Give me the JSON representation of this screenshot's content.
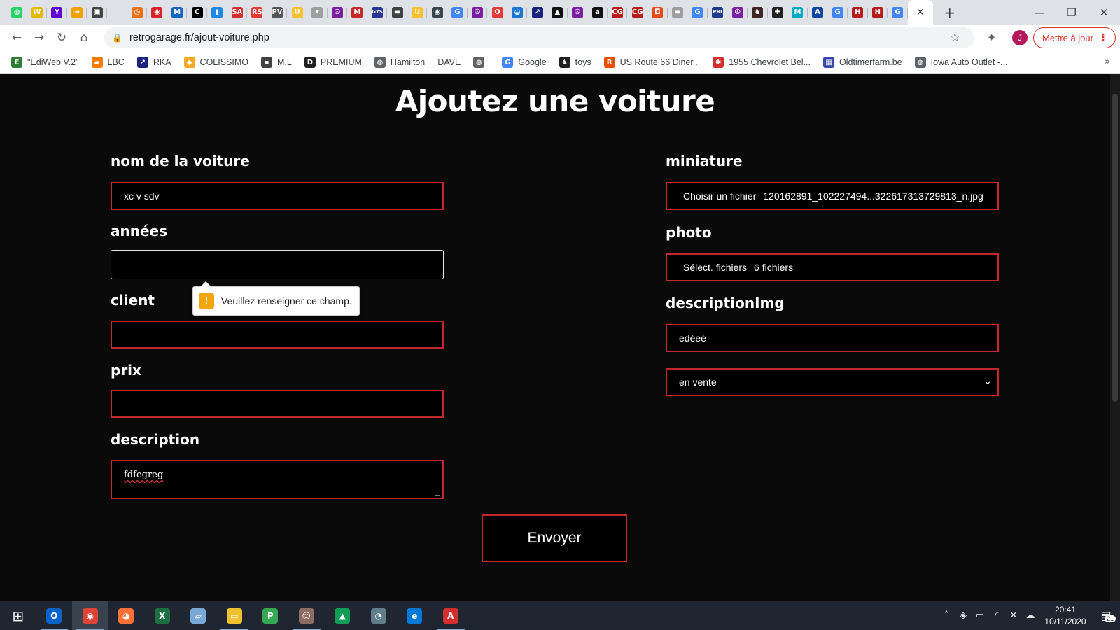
{
  "browser": {
    "tabs": [
      {
        "icon": "whatsapp-icon",
        "glyph": "◍",
        "color": "#25d366"
      },
      {
        "icon": "w-icon",
        "glyph": "W",
        "color": "#e5b800"
      },
      {
        "icon": "yahoo-icon",
        "glyph": "Y",
        "color": "#5f01d1"
      },
      {
        "icon": "arrow-icon",
        "glyph": "➜",
        "color": "#f0a000"
      },
      {
        "icon": "photo-icon",
        "glyph": "▣",
        "color": "#444444"
      },
      {
        "icon": "blank-icon",
        "glyph": "",
        "color": "#dee1e6"
      },
      {
        "icon": "circle-icon",
        "glyph": "◎",
        "color": "#e8711a"
      },
      {
        "icon": "circle-red-icon",
        "glyph": "◉",
        "color": "#d8232a"
      },
      {
        "icon": "m-icon",
        "glyph": "M",
        "color": "#1565c0"
      },
      {
        "icon": "c-icon",
        "glyph": "C",
        "color": "#000000"
      },
      {
        "icon": "bag-icon",
        "glyph": "▮",
        "color": "#1e88e5"
      },
      {
        "icon": "sa-icon",
        "glyph": "SA",
        "color": "#d32f2f"
      },
      {
        "icon": "rs-icon",
        "glyph": "RS",
        "color": "#e53935"
      },
      {
        "icon": "pv-icon",
        "glyph": "PV",
        "color": "#555555"
      },
      {
        "icon": "u-icon",
        "glyph": "U",
        "color": "#fbc02d"
      },
      {
        "icon": "cart-icon",
        "glyph": "▾",
        "color": "#9e9e9e"
      },
      {
        "icon": "peace-icon",
        "glyph": "☮",
        "color": "#7b1fa2"
      },
      {
        "icon": "m-red-icon",
        "glyph": "M",
        "color": "#c62828"
      },
      {
        "icon": "gys-icon",
        "glyph": "GYS",
        "color": "#283593"
      },
      {
        "icon": "bar-icon",
        "glyph": "▬",
        "color": "#424242"
      },
      {
        "icon": "u-yellow-icon",
        "glyph": "U",
        "color": "#fbc02d"
      },
      {
        "icon": "globe-dark-icon",
        "glyph": "◉",
        "color": "#37474f"
      },
      {
        "icon": "google-icon",
        "glyph": "G",
        "color": "#4285f4"
      },
      {
        "icon": "peace-icon",
        "glyph": "☮",
        "color": "#7b1fa2"
      },
      {
        "icon": "opera-icon",
        "glyph": "O",
        "color": "#e53935"
      },
      {
        "icon": "car-icon",
        "glyph": "◒",
        "color": "#1976d2"
      },
      {
        "icon": "rka-icon",
        "glyph": "↗",
        "color": "#1a237e"
      },
      {
        "icon": "hat-icon",
        "glyph": "▲",
        "color": "#111111"
      },
      {
        "icon": "peace-icon",
        "glyph": "☮",
        "color": "#7b1fa2"
      },
      {
        "icon": "amazon-icon",
        "glyph": "a",
        "color": "#111111"
      },
      {
        "icon": "cg-icon",
        "glyph": "CG",
        "color": "#b71c1c"
      },
      {
        "icon": "cg-icon",
        "glyph": "CG",
        "color": "#b71c1c"
      },
      {
        "icon": "orange-icon",
        "glyph": "◘",
        "color": "#e64a19"
      },
      {
        "icon": "bar-light-icon",
        "glyph": "▬",
        "color": "#9e9e9e"
      },
      {
        "icon": "google-icon",
        "glyph": "G",
        "color": "#4285f4"
      },
      {
        "icon": "pri-icon",
        "glyph": "PRI",
        "color": "#1e3a8a"
      },
      {
        "icon": "peace-icon",
        "glyph": "☮",
        "color": "#7b1fa2"
      },
      {
        "icon": "moose-icon",
        "glyph": "♞",
        "color": "#3e2723"
      },
      {
        "icon": "plus-icon",
        "glyph": "✚",
        "color": "#212121"
      },
      {
        "icon": "m-teal-icon",
        "glyph": "M",
        "color": "#00acc1"
      },
      {
        "icon": "a-icon",
        "glyph": "A",
        "color": "#0d47a1"
      },
      {
        "icon": "google-icon",
        "glyph": "G",
        "color": "#4285f4"
      },
      {
        "icon": "h-icon",
        "glyph": "H",
        "color": "#b71c1c"
      },
      {
        "icon": "h-icon",
        "glyph": "H",
        "color": "#b71c1c"
      },
      {
        "icon": "google-icon",
        "glyph": "G",
        "color": "#4285f4"
      }
    ],
    "active_tab_close": "✕",
    "new_tab": "+",
    "window_controls": {
      "minimize": "—",
      "maximize": "❐",
      "close": "✕"
    },
    "nav": {
      "back": "←",
      "forward": "→",
      "reload": "↻",
      "home": "⌂"
    },
    "url": "retrogarage.fr/ajout-voiture.php",
    "lock": "🔒",
    "star": "☆",
    "extensions": "✦",
    "avatar_letter": "J",
    "avatar_color": "#b3185a",
    "update_label": "Mettre à jour",
    "update_menu": "⋮",
    "bookmarks": [
      {
        "label": "\"EdiWeb V.2\"",
        "glyph": "E",
        "color": "#2e7d32"
      },
      {
        "label": "LBC",
        "glyph": "▰",
        "color": "#f57c00"
      },
      {
        "label": "RKA",
        "glyph": "↗",
        "color": "#1a237e"
      },
      {
        "label": "COLISSIMO",
        "glyph": "◆",
        "color": "#f9a825"
      },
      {
        "label": "M.L",
        "glyph": "▪",
        "color": "#424242"
      },
      {
        "label": "PREMIUM",
        "glyph": "D",
        "color": "#212121"
      },
      {
        "label": "Hamilton",
        "glyph": "◍",
        "color": "#5f6368"
      },
      {
        "label": "DAVE",
        "glyph": "",
        "color": "#ffffff"
      },
      {
        "label": "",
        "glyph": "◍",
        "color": "#5f6368"
      },
      {
        "label": "Google",
        "glyph": "G",
        "color": "#4285f4"
      },
      {
        "label": "toys",
        "glyph": "♞",
        "color": "#212121"
      },
      {
        "label": "US Route 66 Diner...",
        "glyph": "R",
        "color": "#e65100"
      },
      {
        "label": "1955 Chevrolet Bel...",
        "glyph": "✱",
        "color": "#d32f2f"
      },
      {
        "label": "Oldtimerfarm.be",
        "glyph": "▦",
        "color": "#3949ab"
      },
      {
        "label": "Iowa Auto Outlet -...",
        "glyph": "◍",
        "color": "#5f6368"
      }
    ],
    "bookmarks_more": "»"
  },
  "page": {
    "title": "Ajoutez une voiture",
    "accent_color": "#c3272b",
    "left_fields": [
      {
        "label": "nom de la voiture",
        "value": "xc v sdv"
      },
      {
        "label": "années",
        "value": ""
      },
      {
        "label": "client",
        "value": ""
      },
      {
        "label": "prix",
        "value": ""
      },
      {
        "label": "description",
        "value": "fdfegreg"
      }
    ],
    "right_fields": {
      "miniature": {
        "label": "miniature",
        "button": "Choisir un fichier",
        "file": "120162891_102227494...322617313729813_n.jpg"
      },
      "photo": {
        "label": "photo",
        "button": "Sélect. fichiers",
        "file": "6 fichiers"
      },
      "description_img": {
        "label": "descriptionImg",
        "value": "edéeé"
      },
      "status_select": {
        "value": "en vente",
        "chevron": "⌄"
      }
    },
    "validation_tooltip": {
      "icon": "!",
      "text": "Veuillez renseigner ce champ."
    },
    "submit_label": "Envoyer"
  },
  "taskbar": {
    "apps": [
      {
        "icon": "windows-start-icon",
        "glyph": "⊞",
        "color": "#1f2632",
        "running": false,
        "active": false
      },
      {
        "icon": "outlook-icon",
        "glyph": "O",
        "color": "#0a64c8",
        "running": true,
        "active": false
      },
      {
        "icon": "chrome-icon",
        "glyph": "◉",
        "color": "#db4437",
        "running": true,
        "active": true
      },
      {
        "icon": "firefox-icon",
        "glyph": "◕",
        "color": "#ff7139",
        "running": false,
        "active": false
      },
      {
        "icon": "excel-icon",
        "glyph": "X",
        "color": "#1d6f42",
        "running": false,
        "active": false
      },
      {
        "icon": "notes-icon",
        "glyph": "▱",
        "color": "#7aa8d6",
        "running": false,
        "active": false
      },
      {
        "icon": "file-explorer-icon",
        "glyph": "▭",
        "color": "#f2c12e",
        "running": true,
        "active": false
      },
      {
        "icon": "green-app-icon",
        "glyph": "P",
        "color": "#34a853",
        "running": false,
        "active": false
      },
      {
        "icon": "people-icon",
        "glyph": "☺",
        "color": "#8d6e63",
        "running": true,
        "active": false
      },
      {
        "icon": "google-drive-icon",
        "glyph": "▲",
        "color": "#0f9d58",
        "running": false,
        "active": false
      },
      {
        "icon": "network-icon",
        "glyph": "◔",
        "color": "#607d8b",
        "running": false,
        "active": false
      },
      {
        "icon": "edge-icon",
        "glyph": "e",
        "color": "#0078d4",
        "running": false,
        "active": false
      },
      {
        "icon": "acrobat-icon",
        "glyph": "A",
        "color": "#d32f2f",
        "running": true,
        "active": false
      }
    ],
    "tray": [
      "˄",
      "◈",
      "▭",
      "◜",
      "✕",
      "☁"
    ],
    "time": "20:41",
    "date": "10/11/2020",
    "notifications_icon": "▤",
    "notifications_count": "21"
  }
}
